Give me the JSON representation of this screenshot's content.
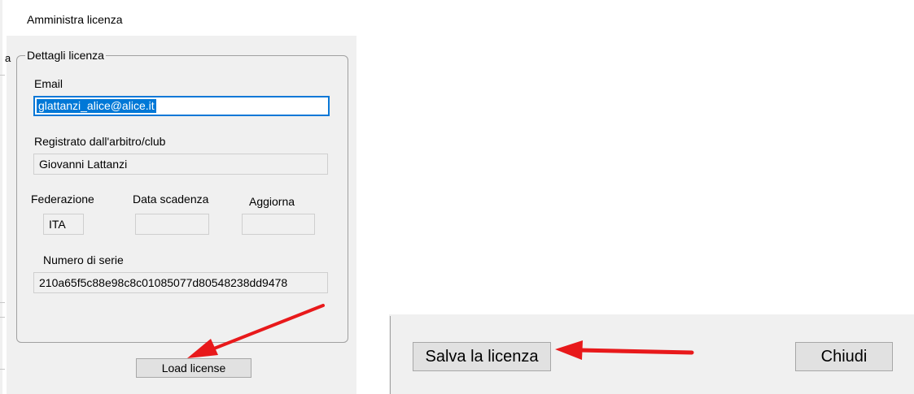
{
  "dialog": {
    "title": "Amministra licenza",
    "edge_glyph": "a",
    "group_title": "Dettagli licenza",
    "email": {
      "label": "Email",
      "value": "glattanzi_alice@alice.it"
    },
    "registered": {
      "label": "Registrato dall'arbitro/club",
      "value": "Giovanni Lattanzi"
    },
    "federation": {
      "label": "Federazione",
      "value": "ITA"
    },
    "expiry": {
      "label": "Data scadenza",
      "value": ""
    },
    "update": {
      "label": "Aggiorna",
      "value": ""
    },
    "serial": {
      "label": "Numero di serie",
      "value": "210a65f5c88e98c8c01085077d80548238dd9478"
    },
    "load_button_label": "Load license"
  },
  "footer": {
    "save_button_label": "Salva la licenza",
    "close_button_label": "Chiudi"
  },
  "colors": {
    "window_bg": "#f0f0f0",
    "selection": "#0078d7",
    "annotation_arrow": "#e8191b"
  }
}
